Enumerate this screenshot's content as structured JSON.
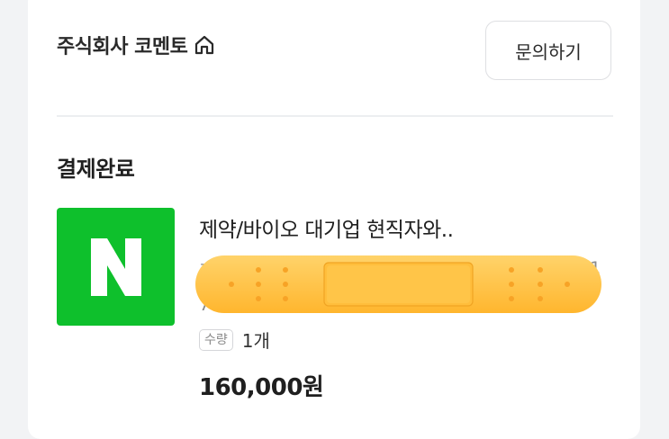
{
  "seller": {
    "name": "주식회사 코멘토",
    "icon": "home-icon"
  },
  "header": {
    "inquiry_label": "문의하기"
  },
  "order": {
    "status": "결제완료",
    "thumbnail": {
      "letter": "N",
      "color": "#0ec02c"
    },
    "product_name": "제약/바이오 대기업 현직자와..",
    "hidden_line_1_start": "결",
    "hidden_line_1_end": "21",
    "hidden_line_2_start": "74",
    "quantity_label": "수량",
    "quantity_value": "1개",
    "price": "160,000원"
  },
  "overlay": {
    "icon": "adhesive-bandage-sticker",
    "color": "#ffc44a"
  }
}
